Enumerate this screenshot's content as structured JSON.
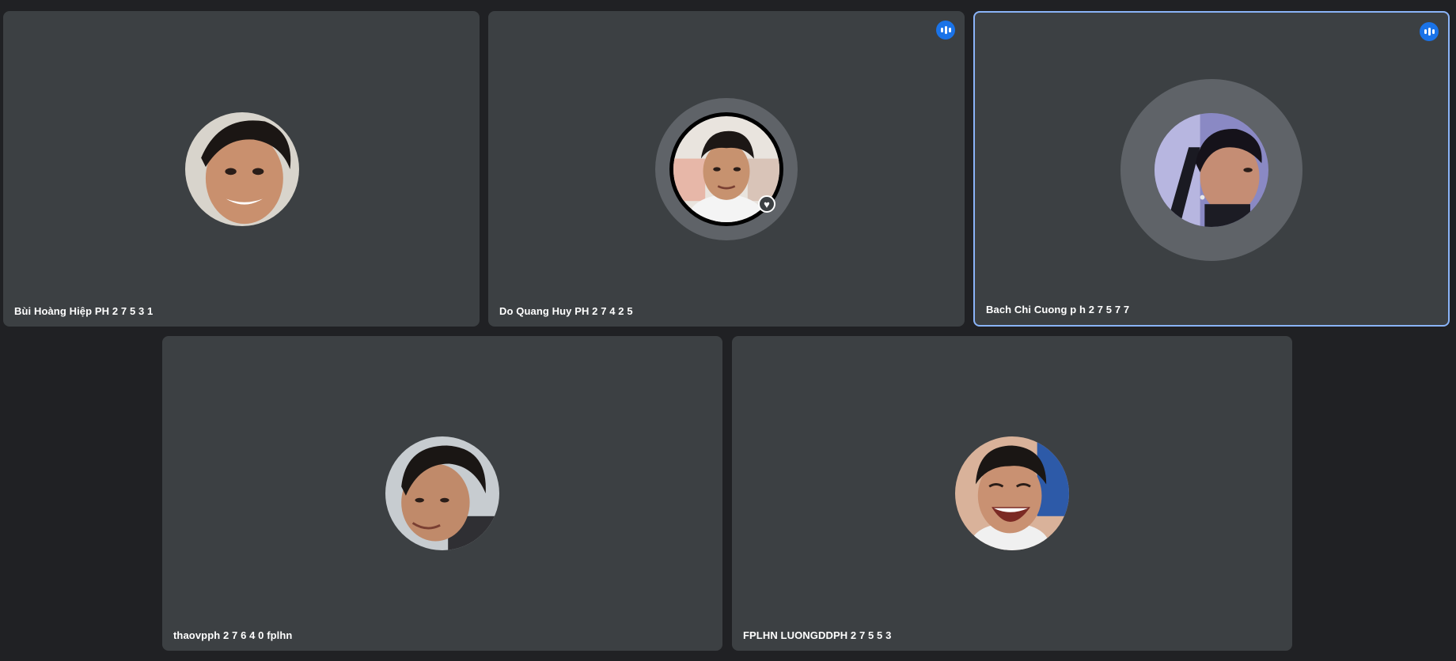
{
  "participants": [
    {
      "name": "Bùi Hoàng Hiệp PH 2 7 5 3 1",
      "speaking": false,
      "active": false
    },
    {
      "name": "Do Quang Huy PH 2 7 4 2 5",
      "speaking": true,
      "active": false
    },
    {
      "name": "Bach Chi Cuong p h 2 7 5 7 7",
      "speaking": true,
      "active": true
    },
    {
      "name": "thaovpph 2 7 6 4 0 fplhn",
      "speaking": false,
      "active": false
    },
    {
      "name": "FPLHN LUONGDDPH 2 7 5 5 3",
      "speaking": false,
      "active": false
    }
  ],
  "colors": {
    "background": "#202124",
    "tile": "#3c4043",
    "active_border": "#8ab4f8",
    "speaking_badge": "#1a73e8",
    "speaking_ring": "#5f6368"
  },
  "icons": {
    "speaking": "audio-level-icon",
    "heart": "heart-icon"
  }
}
